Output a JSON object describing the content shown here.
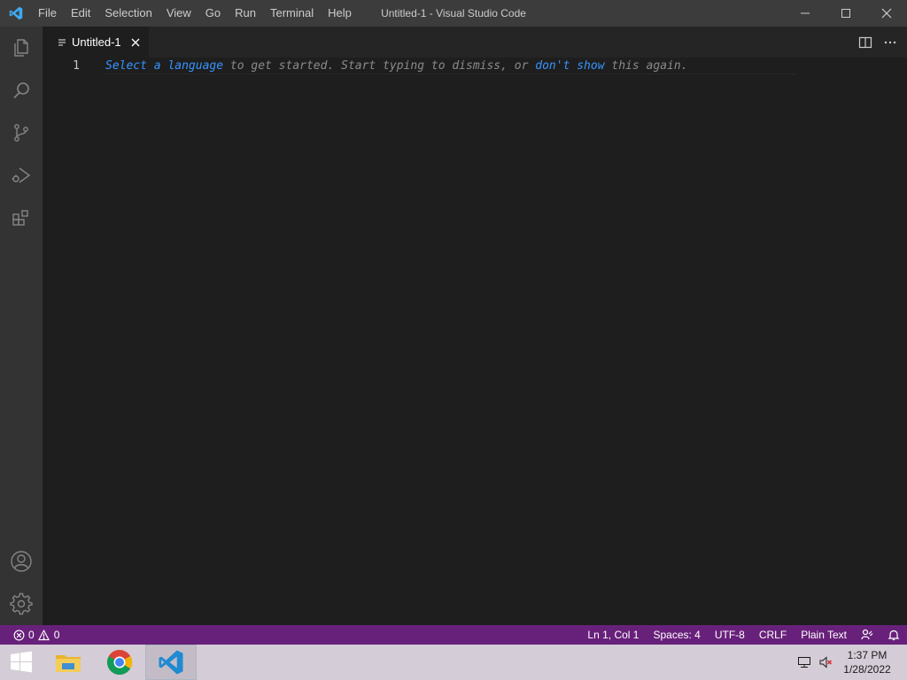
{
  "titlebar": {
    "app_icon": "vscode-logo",
    "menus": [
      "File",
      "Edit",
      "Selection",
      "View",
      "Go",
      "Run",
      "Terminal",
      "Help"
    ],
    "title": "Untitled-1 - Visual Studio Code",
    "controls": [
      "minimize-icon",
      "maximize-icon",
      "close-icon"
    ]
  },
  "activitybar": {
    "top": [
      "explorer-icon",
      "search-icon",
      "source-control-icon",
      "run-debug-icon",
      "extensions-icon"
    ],
    "bottom": [
      "accounts-icon",
      "manage-gear-icon"
    ]
  },
  "tabs": [
    {
      "label": "Untitled-1",
      "active": true,
      "dirty": false
    }
  ],
  "editor_actions": [
    "split-editor-icon",
    "more-actions-icon"
  ],
  "editor": {
    "line_number": "1",
    "hint": {
      "link1": "Select a language",
      "text1": " to get started. Start typing to dismiss, or ",
      "link2": "don't show",
      "text2": " this again."
    }
  },
  "statusbar": {
    "errors": "0",
    "warnings": "0",
    "position": "Ln 1, Col 1",
    "indent": "Spaces: 4",
    "encoding": "UTF-8",
    "eol": "CRLF",
    "language": "Plain Text",
    "background_color": "#68217a"
  },
  "taskbar": {
    "apps": [
      "file-explorer-icon",
      "chrome-icon",
      "vscode-icon"
    ],
    "active_app": "vscode-icon",
    "time": "1:37 PM",
    "date": "1/28/2022"
  },
  "colors": {
    "accent": "#007acc",
    "link": "#3794ff",
    "editor_bg": "#1e1e1e"
  }
}
